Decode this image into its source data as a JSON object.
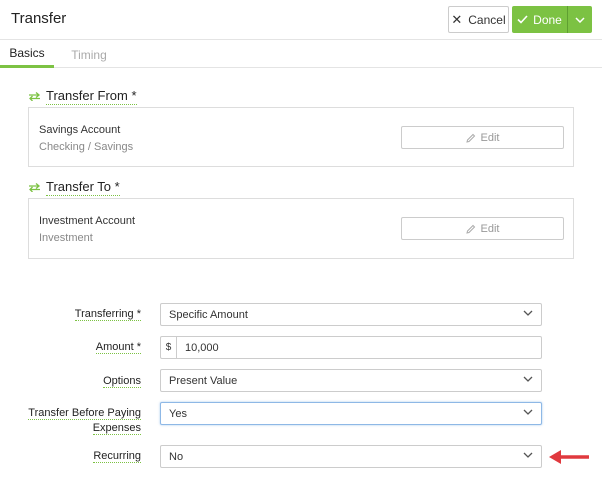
{
  "header": {
    "title": "Transfer",
    "cancel_label": "Cancel",
    "done_label": "Done"
  },
  "tabs": [
    {
      "label": "Basics",
      "active": true
    },
    {
      "label": "Timing",
      "active": false
    }
  ],
  "transfer_from": {
    "title": "Transfer From *",
    "account_name": "Savings Account",
    "account_type": "Checking / Savings",
    "edit_label": "Edit"
  },
  "transfer_to": {
    "title": "Transfer To *",
    "account_name": "Investment Account",
    "account_type": "Investment",
    "edit_label": "Edit"
  },
  "form": {
    "transferring": {
      "label": "Transferring *",
      "value": "Specific Amount"
    },
    "amount": {
      "label": "Amount *",
      "prefix": "$",
      "value": "10,000"
    },
    "options": {
      "label": "Options",
      "value": "Present Value"
    },
    "transfer_before": {
      "label_line1": "Transfer Before Paying",
      "label_line2": "Expenses",
      "value": "Yes"
    },
    "recurring": {
      "label": "Recurring",
      "value": "No"
    }
  },
  "colors": {
    "accent_green": "#7cc243",
    "arrow_red": "#e0393e",
    "focus_blue": "#8eb8e6"
  }
}
